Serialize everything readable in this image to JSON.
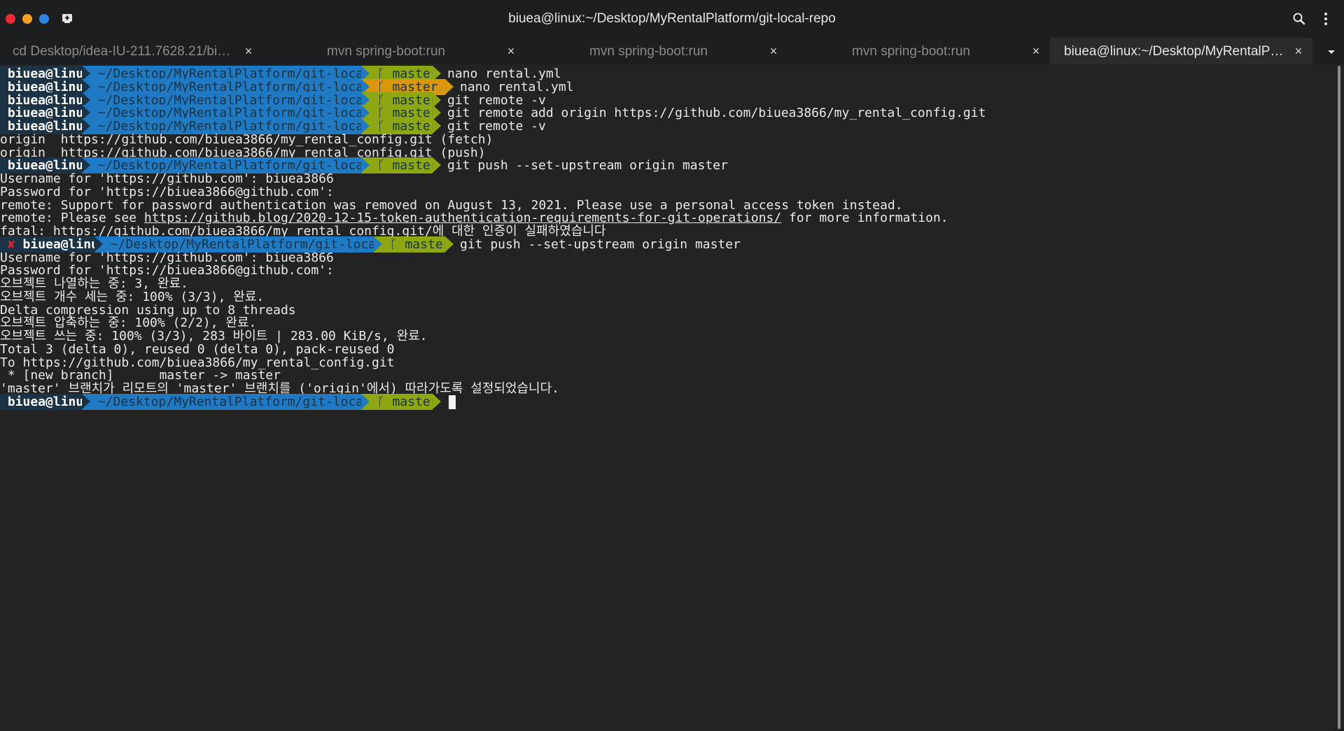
{
  "window": {
    "title": "biuea@linux:~/Desktop/MyRentalPlatform/git-local-repo",
    "colors": {
      "close": "#ee2c35",
      "minimize": "#f4a124",
      "maximize": "#2f83e6",
      "prompt_user_bg": "#1b3344",
      "prompt_dir_bg": "#1f7ac3",
      "prompt_git_bg": "#8da712",
      "prompt_git_dirty_bg": "#d8960c",
      "error_mark": "#e0242a"
    },
    "icons": {
      "new_tab": "new-tab-icon",
      "search": "search-icon",
      "menu": "kebab-menu-icon",
      "tab_close": "×",
      "tabs_dropdown": "chevron-down-icon"
    }
  },
  "tabs": [
    {
      "label": "cd Desktop/idea-IU-211.7628.21/bin··· ",
      "close": "×"
    },
    {
      "label": "mvn spring-boot:run",
      "close": "×"
    },
    {
      "label": "mvn spring-boot:run",
      "close": "×"
    },
    {
      "label": "mvn spring-boot:run",
      "close": "×"
    },
    {
      "label": "biuea@linux:~/Desktop/MyRentalPl··· ",
      "close": "×"
    }
  ],
  "prompt": {
    "user": " biuea@linux ",
    "dir": " ~/Desktop/MyRentalPlatform/git-local-repo ",
    "branch": " ᚴ master ",
    "branch_dirty": " ᚴ master ± ",
    "error_mark": "✘"
  },
  "terminal": {
    "lines": [
      {
        "prompt": true,
        "dirty": false,
        "error": false,
        "cmd": "nano rental.yml"
      },
      {
        "prompt": true,
        "dirty": true,
        "error": false,
        "cmd": "nano rental.yml"
      },
      {
        "prompt": true,
        "dirty": false,
        "error": false,
        "cmd": "git remote -v"
      },
      {
        "prompt": true,
        "dirty": false,
        "error": false,
        "cmd": "git remote add origin https://github.com/biuea3866/my_rental_config.git"
      },
      {
        "prompt": true,
        "dirty": false,
        "error": false,
        "cmd": "git remote -v"
      },
      {
        "text": "origin  https://github.com/biuea3866/my_rental_config.git (fetch)"
      },
      {
        "text": "origin  https://github.com/biuea3866/my_rental_config.git (push)"
      },
      {
        "prompt": true,
        "dirty": false,
        "error": false,
        "cmd": "git push --set-upstream origin master"
      },
      {
        "text": "Username for 'https://github.com': biuea3866"
      },
      {
        "text": "Password for 'https://biuea3866@github.com':"
      },
      {
        "text": "remote: Support for password authentication was removed on August 13, 2021. Please use a personal access token instead."
      },
      {
        "text_before": "remote: Please see ",
        "link": "https://github.blog/2020-12-15-token-authentication-requirements-for-git-operations/",
        "text_after": " for more information."
      },
      {
        "text": "fatal: https://github.com/biuea3866/my_rental_config.git/에 대한 인증이 실패하였습니다"
      },
      {
        "prompt": true,
        "dirty": false,
        "error": true,
        "cmd": "git push --set-upstream origin master"
      },
      {
        "text": "Username for 'https://github.com': biuea3866"
      },
      {
        "text": "Password for 'https://biuea3866@github.com':"
      },
      {
        "text": "오브젝트 나열하는 중: 3, 완료."
      },
      {
        "text": "오브젝트 개수 세는 중: 100% (3/3), 완료."
      },
      {
        "text": "Delta compression using up to 8 threads"
      },
      {
        "text": "오브젝트 압축하는 중: 100% (2/2), 완료."
      },
      {
        "text": "오브젝트 쓰는 중: 100% (3/3), 283 바이트 | 283.00 KiB/s, 완료."
      },
      {
        "text": "Total 3 (delta 0), reused 0 (delta 0), pack-reused 0"
      },
      {
        "text": "To https://github.com/biuea3866/my_rental_config.git"
      },
      {
        "text": " * [new branch]      master -> master"
      },
      {
        "text": "'master' 브랜치가 리모트의 'master' 브랜치를 ('origin'에서) 따라가도록 설정되었습니다."
      },
      {
        "prompt": true,
        "dirty": false,
        "error": false,
        "cmd": "",
        "cursor": true
      }
    ]
  }
}
